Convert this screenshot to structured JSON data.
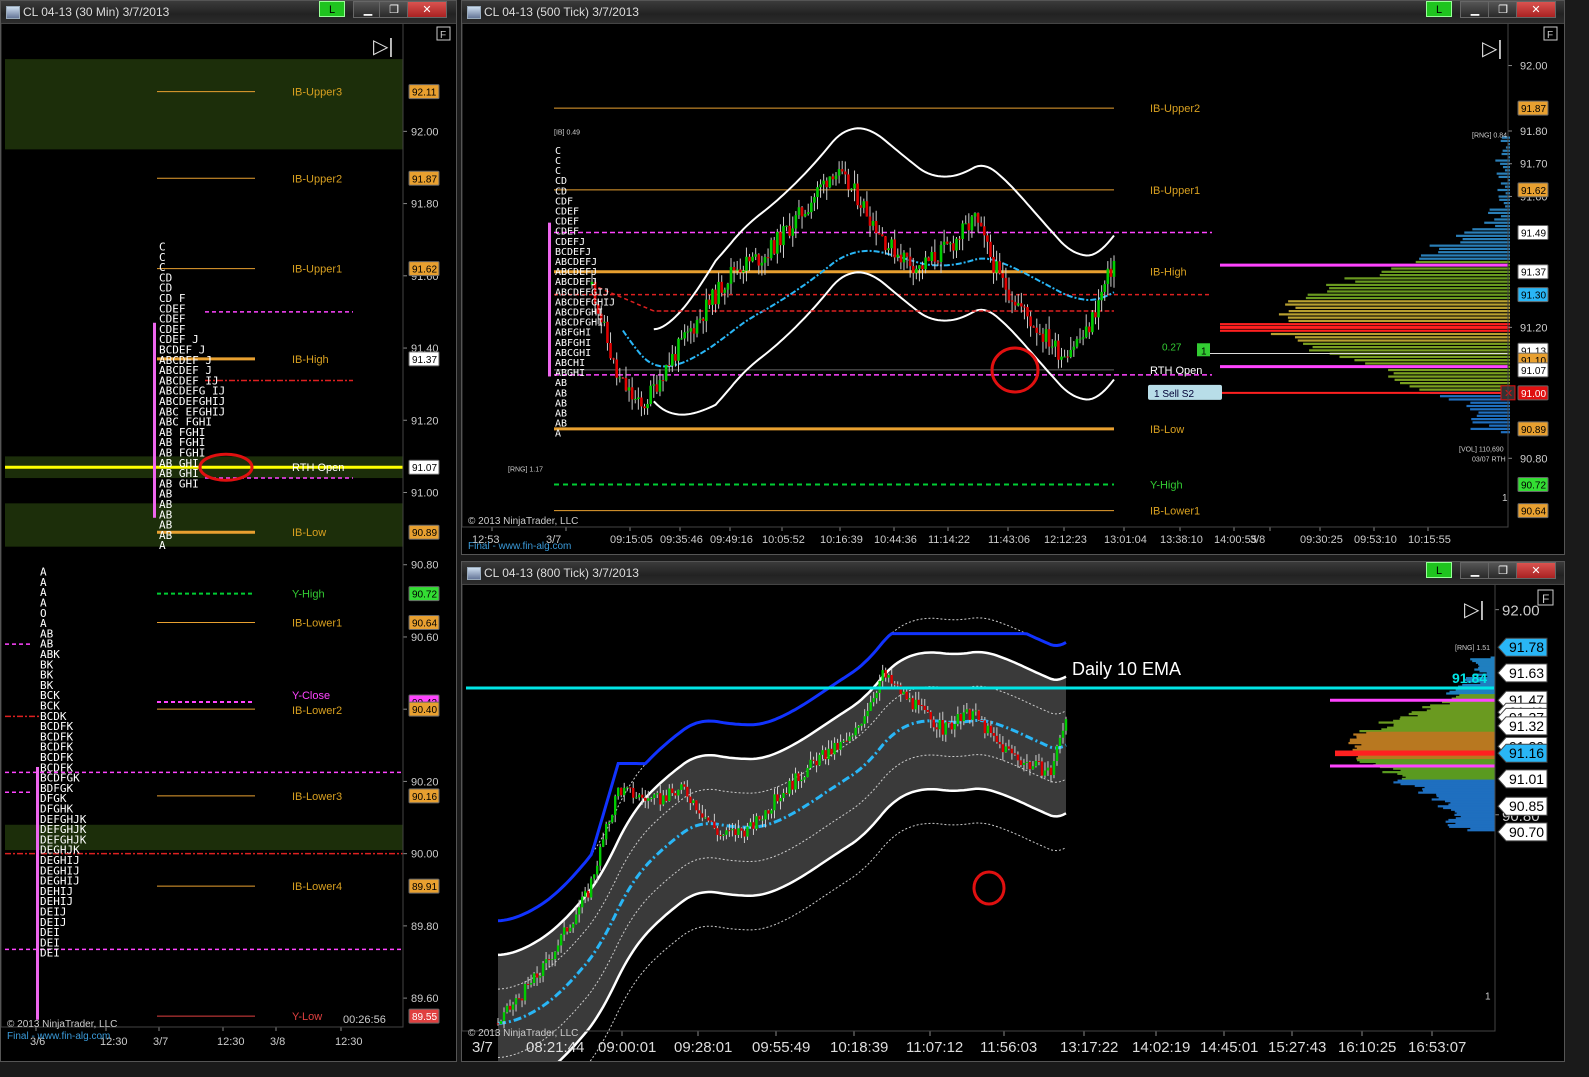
{
  "windows": {
    "w1": {
      "title": "CL 04-13 (30 Min)  3/7/2013",
      "lbtn": "L",
      "copyright": "© 2013 NinjaTrader, LLC",
      "website": "Final - www.fin-alg.com",
      "timer": "00:26:56"
    },
    "w2": {
      "title": "CL 04-13 (500 Tick)  3/7/2013",
      "lbtn": "L",
      "copyright": "© 2013 NinjaTrader, LLC",
      "website": "Final - www.fin-alg.com"
    },
    "w3": {
      "title": "CL 04-13 (800 Tick)  3/7/2013",
      "lbtn": "L",
      "copyright": "© 2013 NinjaTrader, LLC",
      "ema_label": "Daily 10 EMA",
      "ema_value": "91.84"
    }
  },
  "controls": {
    "minimize": "▁",
    "restore": "❐",
    "close": "✕",
    "play": "▷|",
    "f_label": "F"
  },
  "colors": {
    "bg": "#000000",
    "up": "#00cc00",
    "down": "#dd0000",
    "ib": "#e8a030",
    "magenta": "#ff44ff",
    "cyan": "#00e5e5",
    "yhigh": "#00cc33",
    "blue": "#1133ff",
    "label_gold": "#d8a020",
    "label_green": "#33cc33",
    "label_blue": "#29b6f6"
  },
  "chart_data": [
    {
      "type": "line",
      "title": "CL 04-13 (30 Min) 3/7/2013",
      "ylim": [
        89.52,
        92.3
      ],
      "y_ticks": [
        "92.00",
        "91.80",
        "91.60",
        "91.40",
        "91.20",
        "91.00",
        "90.80",
        "90.60",
        "90.40",
        "90.20",
        "90.00",
        "89.80",
        "89.60"
      ],
      "x_ticks": [
        "3/6",
        "12:30",
        "3/7",
        "12:30",
        "3/8",
        "12:30"
      ],
      "levels": [
        {
          "name": "IB-Upper3",
          "value": 92.11
        },
        {
          "name": "IB-Upper2",
          "value": 91.87
        },
        {
          "name": "IB-Upper1",
          "value": 91.62
        },
        {
          "name": "IB-High",
          "value": 91.37
        },
        {
          "name": "RTH Open",
          "value": 91.07
        },
        {
          "name": "IB-Low",
          "value": 90.89
        },
        {
          "name": "Y-High",
          "value": 90.72
        },
        {
          "name": "IB-Lower1",
          "value": 90.64
        },
        {
          "name": "Y-Close",
          "value": 90.42
        },
        {
          "name": "IB-Lower2",
          "value": 90.4
        },
        {
          "name": "IB-Lower3",
          "value": 90.16
        },
        {
          "name": "IB-Lower4",
          "value": 89.91
        },
        {
          "name": "Y-Low",
          "value": 89.55
        }
      ],
      "price_labels": [
        "92.11",
        "91.87",
        "91.62",
        "91.37",
        "91.07",
        "90.89",
        "90.72",
        "90.64",
        "90.42",
        "90.40",
        "90.16",
        "89.91",
        "89.55"
      ],
      "tpo_today": [
        "C",
        "C",
        "C",
        "CD",
        "CD",
        "CD  F",
        "CDEF",
        "CDEF",
        "CDEF",
        "CDEF     J",
        "BCDEF     J",
        "ABCDEF    J",
        "ABCDEF    J",
        "ABCDEF  IJ",
        "ABCDEFG IJ",
        "ABCDEFGHIJ",
        "ABC  EFGHIJ",
        "ABC   FGHI",
        "AB    FGHI",
        "AB    FGHI",
        "AB    FGHI",
        "AB     GHI",
        "AB     GHI",
        "AB     GHI",
        "AB",
        "AB",
        "AB",
        "AB",
        "AB",
        "A"
      ],
      "tpo_prev": [
        "A",
        "A",
        "A",
        "A",
        "O",
        "A",
        "AB",
        "AB",
        "ABK",
        "BK",
        "BK",
        "BK",
        "BCK",
        "BCK",
        "BCDK",
        "BCDFK",
        "BCDFK",
        "BCDFK",
        "BCDFK",
        "BCDFK",
        "BCDFGK",
        "BDFGK",
        "DFGK",
        "DFGHK",
        "DEFGHJK",
        "DEFGHJK",
        "DEFGHJK",
        "DEGHJK",
        "DEGHIJ",
        "DEGHIJ",
        "DEGHIJ",
        "DEHIJ",
        "DEHIJ",
        "DEIJ",
        "DEIJ",
        "DEI",
        "DEI",
        "DEI"
      ]
    },
    {
      "type": "line",
      "title": "CL 04-13 (500 Tick) 3/7/2013",
      "ylim": [
        90.59,
        92.13
      ],
      "y_ticks": [
        "92.00",
        "91.80",
        "91.70",
        "91.60",
        "91.20",
        "90.80"
      ],
      "x_ticks": [
        "12:53",
        "3/7",
        "09:15:05",
        "09:35:46",
        "09:49:16",
        "10:05:52",
        "10:16:39",
        "10:44:36",
        "11:14:22",
        "11:43:06",
        "12:12:23",
        "13:01:04",
        "13:38:10",
        "14:00:55",
        "3/8",
        "09:30:25",
        "09:53:10",
        "10:15:55"
      ],
      "levels": [
        {
          "name": "IB-Upper2",
          "value": 91.87
        },
        {
          "name": "IB-Upper1",
          "value": 91.62
        },
        {
          "name": "IB-High",
          "value": 91.37
        },
        {
          "name": "RTH Open",
          "value": 91.07
        },
        {
          "name": "IB-Low",
          "value": 90.89
        },
        {
          "name": "Y-High",
          "value": 90.72
        },
        {
          "name": "IB-Lower1",
          "value": 90.64
        }
      ],
      "price_labels": [
        "91.87",
        "91.62",
        "91.49",
        "91.37",
        "91.30",
        "91.13",
        "91.10",
        "91.07",
        "91.00",
        "90.89",
        "90.72",
        "90.64"
      ],
      "annotations": [
        "[IB] 0.49",
        "[RNG] 1.17",
        "[RNG] 0.84",
        "[VOL] 110,690",
        "03/07 RTH",
        "0.27",
        "1",
        "1  Sell S2",
        "1"
      ],
      "tpo_profile": [
        "C",
        "C",
        "C",
        "CD",
        "CD",
        "CDF",
        "CDEF",
        "CDEF",
        "CDEF",
        "CDEFJ",
        "BCDEFJ",
        "ABCDEFJ",
        "ABCDEFJ",
        "ABCDEFJ",
        "ABCDEFGIJ",
        "ABCDEFGHIJ",
        "ABCDFGHI",
        "ABCDFGHI",
        "ABFGHI",
        "ABFGHI",
        "ABCGHI",
        "ABCHI",
        "ABGHI",
        "AB",
        "AB",
        "AB",
        "AB",
        "AB",
        "A"
      ]
    },
    {
      "type": "line",
      "title": "CL 04-13 (800 Tick) 3/7/2013",
      "ylim": [
        89.535,
        92.15
      ],
      "y_ticks": [
        "92.00",
        "90.80"
      ],
      "x_ticks": [
        "3/7",
        "08:21:44",
        "09:00:01",
        "09:28:01",
        "09:55:49",
        "10:18:39",
        "11:07:12",
        "11:56:03",
        "13:17:22",
        "14:02:19",
        "14:45:01",
        "15:27:43",
        "16:10:25",
        "16:53:07"
      ],
      "price_labels": [
        "91.78",
        "91.63",
        "91.47",
        "91.40",
        "91.37",
        "91.32",
        "91.20",
        "91.16",
        "91.01",
        "90.85",
        "90.70"
      ],
      "annotations": [
        "[RNG] 1.51",
        "1"
      ]
    }
  ]
}
